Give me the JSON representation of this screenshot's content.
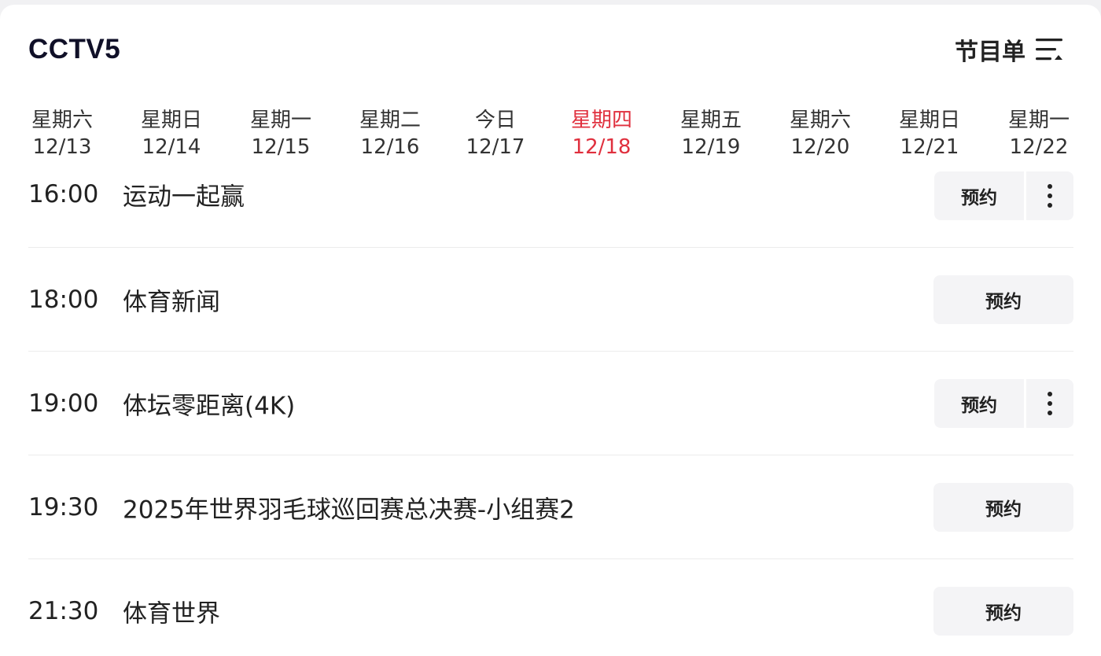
{
  "header": {
    "channel": "CCTV5",
    "schedule_label": "节目单",
    "schedule_icon": "program-list-icon"
  },
  "days": [
    {
      "weekday": "星期六",
      "date": "12/13",
      "active": false
    },
    {
      "weekday": "星期日",
      "date": "12/14",
      "active": false
    },
    {
      "weekday": "星期一",
      "date": "12/15",
      "active": false
    },
    {
      "weekday": "星期二",
      "date": "12/16",
      "active": false
    },
    {
      "weekday": "今日",
      "date": "12/17",
      "active": false
    },
    {
      "weekday": "星期四",
      "date": "12/18",
      "active": true
    },
    {
      "weekday": "星期五",
      "date": "12/19",
      "active": false
    },
    {
      "weekday": "星期六",
      "date": "12/20",
      "active": false
    },
    {
      "weekday": "星期日",
      "date": "12/21",
      "active": false
    },
    {
      "weekday": "星期一",
      "date": "12/22",
      "active": false
    }
  ],
  "programs": [
    {
      "time": "16:00",
      "title": "运动一起赢",
      "reserve_label": "预约",
      "has_more": true
    },
    {
      "time": "18:00",
      "title": "体育新闻",
      "reserve_label": "预约",
      "has_more": false
    },
    {
      "time": "19:00",
      "title": "体坛零距离(4K)",
      "reserve_label": "预约",
      "has_more": true
    },
    {
      "time": "19:30",
      "title": "2025年世界羽毛球巡回赛总决赛-小组赛2",
      "reserve_label": "预约",
      "has_more": false
    },
    {
      "time": "21:30",
      "title": "体育世界",
      "reserve_label": "预约",
      "has_more": false
    }
  ],
  "colors": {
    "accent": "#e0303e",
    "title": "#101028",
    "button_bg": "#f4f4f6",
    "divider": "#ececec"
  }
}
